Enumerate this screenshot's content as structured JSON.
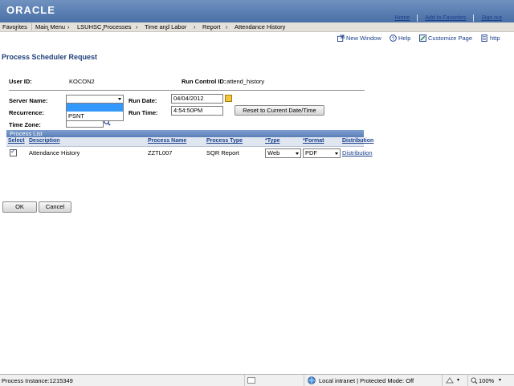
{
  "header": {
    "logo": "ORACLE",
    "links": [
      "Home",
      "Add to Favorites",
      "Sign out"
    ]
  },
  "nav": {
    "items": [
      "Favorites",
      "Main Menu",
      "LSUHSC Processes",
      "Time and Labor",
      "Report",
      "Attendance History"
    ],
    "breadcrumb_separator": "›"
  },
  "utility": {
    "new_window": "New Window",
    "help": "Help",
    "customize_page": "Customize Page",
    "http": "http"
  },
  "page": {
    "title": "Process Scheduler Request",
    "user_id_label": "User ID:",
    "user_id_value": "KOCON2",
    "run_control_label": "Run Control ID:",
    "run_control_value": "attend_history",
    "server_name_label": "Server Name:",
    "server_name_value": "",
    "server_options": [
      "PSNT"
    ],
    "recurrence_label": "Recurrence:",
    "time_zone_label": "Time Zone:",
    "run_date_label": "Run Date:",
    "run_date_value": "04/04/2012",
    "run_time_label": "Run Time:",
    "run_time_value": "4:54:50PM",
    "reset_button": "Reset to Current Date/Time"
  },
  "process_list": {
    "title": "Process List",
    "headers": [
      "Select",
      "Description",
      "Process Name",
      "Process Type",
      "*Type",
      "*Format",
      "Distribution"
    ],
    "rows": [
      {
        "selected": true,
        "description": "Attendance History",
        "process_name": "ZZTL007",
        "process_type": "SQR Report",
        "type": "Web",
        "format": "PDF",
        "distribution": "Distribution"
      }
    ]
  },
  "buttons": {
    "ok": "OK",
    "cancel": "Cancel"
  },
  "status_bar": {
    "process_instance": "Process Instance:1215349",
    "zone": "Local intranet | Protected Mode: Off",
    "zoom": "100%"
  },
  "colors": {
    "header_top": "#6f92c0",
    "header_bottom": "#4a6fa5",
    "title": "#1e3f7a",
    "link": "#1a3f8c",
    "selected_option": "#3399ff"
  }
}
